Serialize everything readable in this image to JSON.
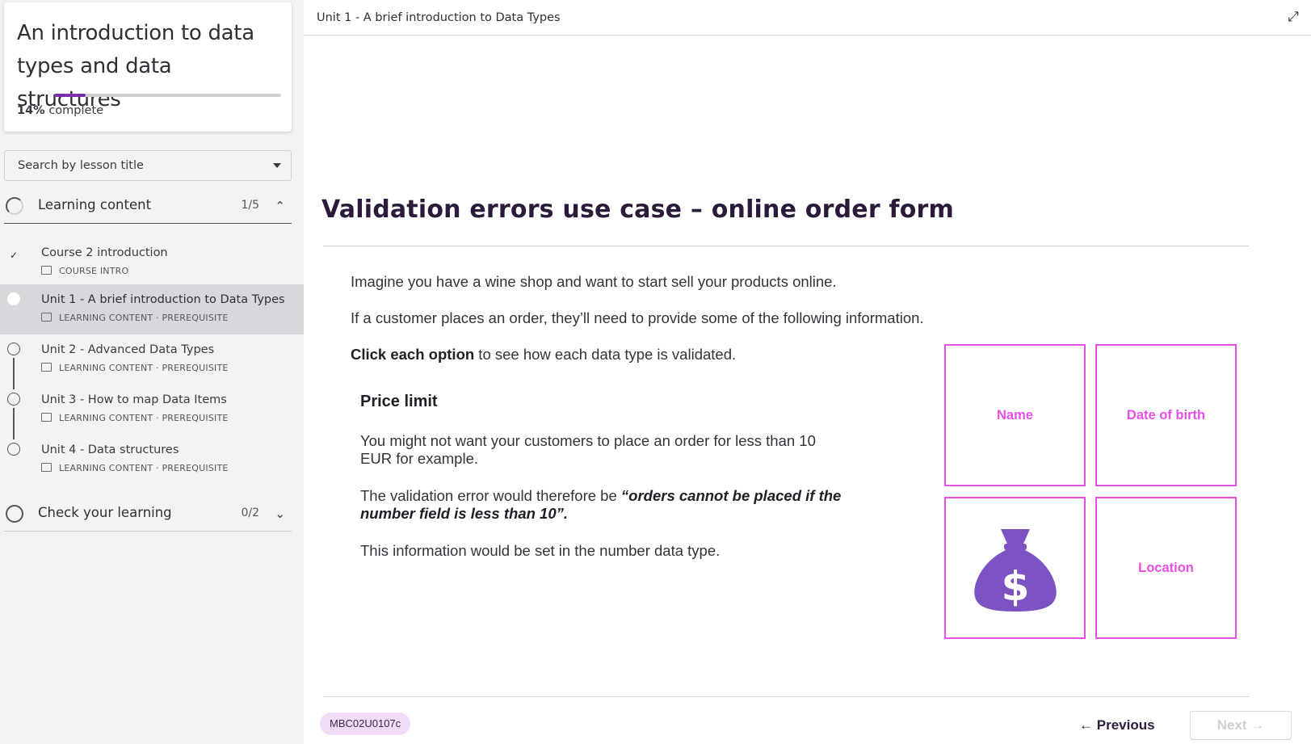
{
  "course": {
    "title": "An introduction to data types and data structures",
    "progress_percent": 14,
    "progress_pct_label": "14%",
    "progress_suffix": "complete"
  },
  "search": {
    "label": "Search by lesson title"
  },
  "sections": [
    {
      "label": "Learning content",
      "count": "1/5",
      "expanded": true
    },
    {
      "label": "Check your learning",
      "count": "0/2",
      "expanded": false
    }
  ],
  "lessons": [
    {
      "title": "Course 2 introduction",
      "meta": "COURSE INTRO",
      "status": "completed"
    },
    {
      "title": "Unit 1 - A brief introduction to Data Types",
      "meta": "LEARNING CONTENT · PREREQUISITE",
      "status": "current"
    },
    {
      "title": "Unit 2 - Advanced Data Types",
      "meta": "LEARNING CONTENT · PREREQUISITE",
      "status": "not-started"
    },
    {
      "title": "Unit 3 - How to map Data Items",
      "meta": "LEARNING CONTENT · PREREQUISITE",
      "status": "not-started"
    },
    {
      "title": "Unit 4 - Data structures",
      "meta": "LEARNING CONTENT · PREREQUISITE",
      "status": "not-started"
    }
  ],
  "header": {
    "breadcrumb": "Unit 1 - A brief introduction to Data Types"
  },
  "content": {
    "heading": "Validation errors use case – online order form",
    "para1": "Imagine you have a wine shop and want to start sell your products online.",
    "para2": "If a customer places an order, they’ll need to provide some of the following information.",
    "instruction_bold": "Click each option",
    "instruction_rest": " to see how each data type is validated.",
    "detail": {
      "title": "Price limit",
      "text1": "You might not want your customers to place an order for less than 10 EUR for example.",
      "text2_prefix": "The validation error would therefore be ",
      "text2_quote": "“orders cannot be placed if the number field is less than 10”.",
      "text3": "This information would be set in the number data type."
    },
    "tiles": [
      {
        "label": "Name"
      },
      {
        "label": "Date of birth"
      },
      {
        "label": "",
        "icon": "money-bag-dollar-icon"
      },
      {
        "label": "Location"
      }
    ]
  },
  "footer": {
    "code": "MBC02U0107c",
    "previous_label": "Previous",
    "next_label": "Next"
  },
  "colors": {
    "accent": "#7a2fb0",
    "tile_border": "#e94ee6",
    "icon_purple": "#7d52c3",
    "heading": "#2b1a3a"
  }
}
